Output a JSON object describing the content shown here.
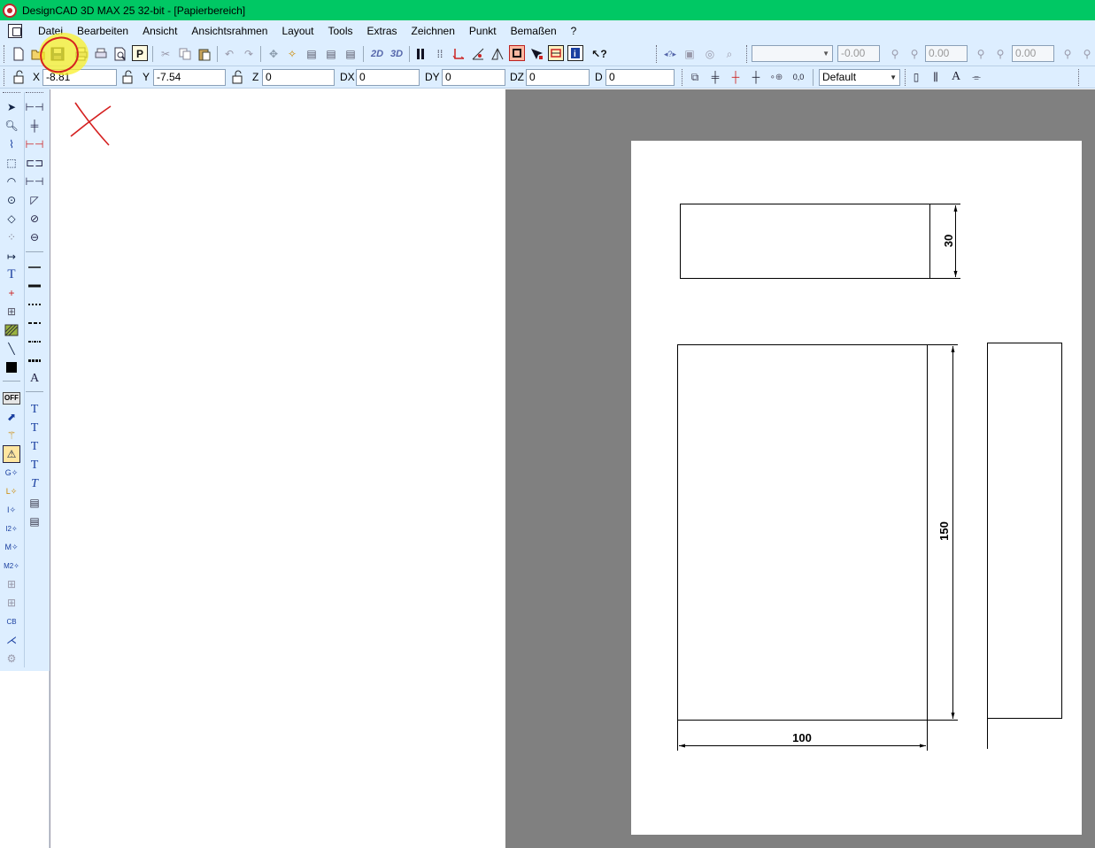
{
  "window": {
    "title": "DesignCAD 3D MAX 25 32-bit - [Papierbereich]"
  },
  "menu": {
    "items": [
      "Datei",
      "Bearbeiten",
      "Ansicht",
      "Ansichtsrahmen",
      "Layout",
      "Tools",
      "Extras",
      "Zeichnen",
      "Punkt",
      "Bemaßen",
      "?"
    ]
  },
  "toolbar1": {
    "labels_2d3d": [
      "2D",
      "3D"
    ],
    "fields": [
      "-0.00",
      "0.00",
      "0.00"
    ]
  },
  "coords": {
    "x_label": "X",
    "x_value": "-8.81",
    "y_label": "Y",
    "y_value": "-7.54",
    "z_label": "Z",
    "z_value": "0",
    "dx_label": "DX",
    "dx_value": "0",
    "dy_label": "DY",
    "dy_value": "0",
    "dz_label": "DZ",
    "dz_value": "0",
    "d_label": "D",
    "d_value": "0",
    "layer_select": "Default",
    "snap_label": "0,0"
  },
  "left_tools": {
    "off_label": "OFF"
  },
  "drawing": {
    "dim_top_height": "30",
    "dim_front_height": "150",
    "dim_front_width": "100"
  },
  "colors": {
    "titlebar": "#00c864",
    "toolbar": "#ddeeff",
    "annotation_red": "#d52020",
    "highlight_yellow": "#f5ee2a"
  }
}
